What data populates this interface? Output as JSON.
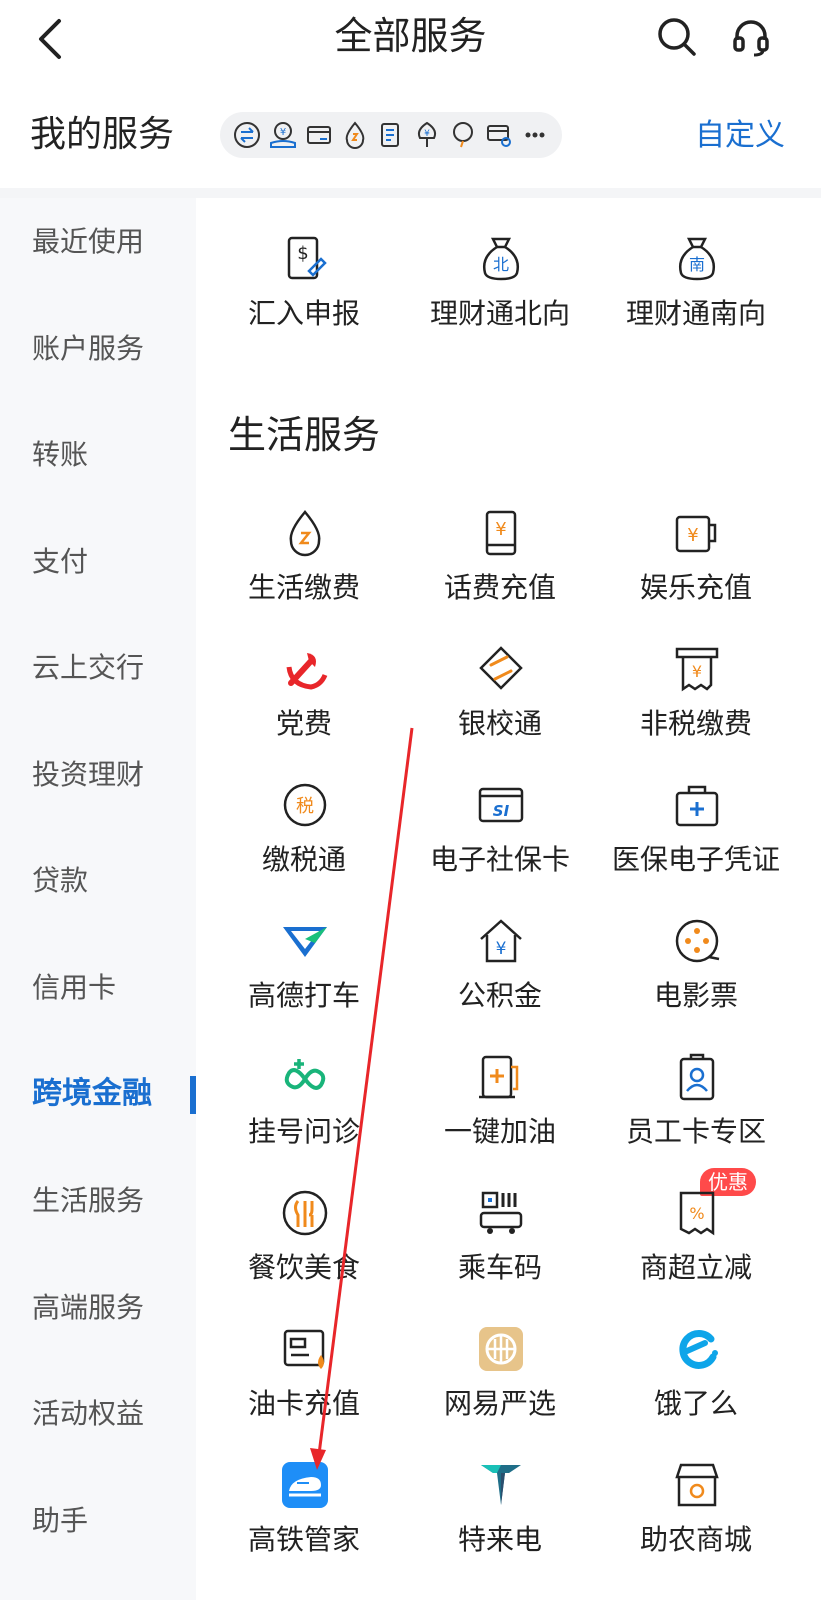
{
  "header": {
    "title": "全部服务"
  },
  "my_services": {
    "title": "我的服务",
    "customize_label": "自定义",
    "icons": [
      "exchange-icon",
      "yuan-hand-icon",
      "card-icon",
      "drop-icon",
      "document-icon",
      "yuan-tree-icon",
      "balloon-icon",
      "card-link-icon",
      "more-dots-icon"
    ]
  },
  "sidebar": {
    "items": [
      {
        "label": "最近使用"
      },
      {
        "label": "账户服务"
      },
      {
        "label": "转账"
      },
      {
        "label": "支付"
      },
      {
        "label": "云上交行"
      },
      {
        "label": "投资理财"
      },
      {
        "label": "贷款"
      },
      {
        "label": "信用卡"
      },
      {
        "label": "跨境金融",
        "active": true
      },
      {
        "label": "生活服务"
      },
      {
        "label": "高端服务"
      },
      {
        "label": "活动权益"
      },
      {
        "label": "助手"
      }
    ]
  },
  "cross_border": {
    "items": [
      {
        "label": "汇入申报",
        "icon": "dollar-doc-icon"
      },
      {
        "label": "理财通北向",
        "icon": "bag-north-icon",
        "icon_text": "北"
      },
      {
        "label": "理财通南向",
        "icon": "bag-south-icon",
        "icon_text": "南"
      }
    ]
  },
  "life": {
    "title": "生活服务",
    "badge": "优惠",
    "items": [
      {
        "label": "生活缴费",
        "icon": "drop-icon"
      },
      {
        "label": "话费充值",
        "icon": "phone-yuan-icon"
      },
      {
        "label": "娱乐充值",
        "icon": "cup-yuan-icon"
      },
      {
        "label": "党费",
        "icon": "party-emblem-icon"
      },
      {
        "label": "银校通",
        "icon": "school-pay-icon"
      },
      {
        "label": "非税缴费",
        "icon": "receipt-yuan-icon"
      },
      {
        "label": "缴税通",
        "icon": "tax-icon",
        "icon_text": "税"
      },
      {
        "label": "电子社保卡",
        "icon": "social-card-icon",
        "icon_text": "SI"
      },
      {
        "label": "医保电子凭证",
        "icon": "medical-kit-icon"
      },
      {
        "label": "高德打车",
        "icon": "amap-logo-icon"
      },
      {
        "label": "公积金",
        "icon": "house-yuan-icon"
      },
      {
        "label": "电影票",
        "icon": "film-reel-icon"
      },
      {
        "label": "挂号问诊",
        "icon": "medical-loop-icon"
      },
      {
        "label": "一键加油",
        "icon": "fuel-pump-icon"
      },
      {
        "label": "员工卡专区",
        "icon": "badge-card-icon"
      },
      {
        "label": "餐饮美食",
        "icon": "utensils-icon"
      },
      {
        "label": "乘车码",
        "icon": "bus-qr-icon"
      },
      {
        "label": "商超立减",
        "icon": "percent-receipt-icon"
      },
      {
        "label": "油卡充值",
        "icon": "fuel-card-icon"
      },
      {
        "label": "网易严选",
        "icon": "yanxuan-logo-icon"
      },
      {
        "label": "饿了么",
        "icon": "eleme-logo-icon"
      },
      {
        "label": "高铁管家",
        "icon": "train-logo-icon"
      },
      {
        "label": "特来电",
        "icon": "teld-logo-icon"
      },
      {
        "label": "助农商城",
        "icon": "shop-icon"
      }
    ]
  },
  "colors": {
    "accent": "#1a6fd0",
    "orange": "#f08a1c",
    "red": "#e8262a"
  }
}
